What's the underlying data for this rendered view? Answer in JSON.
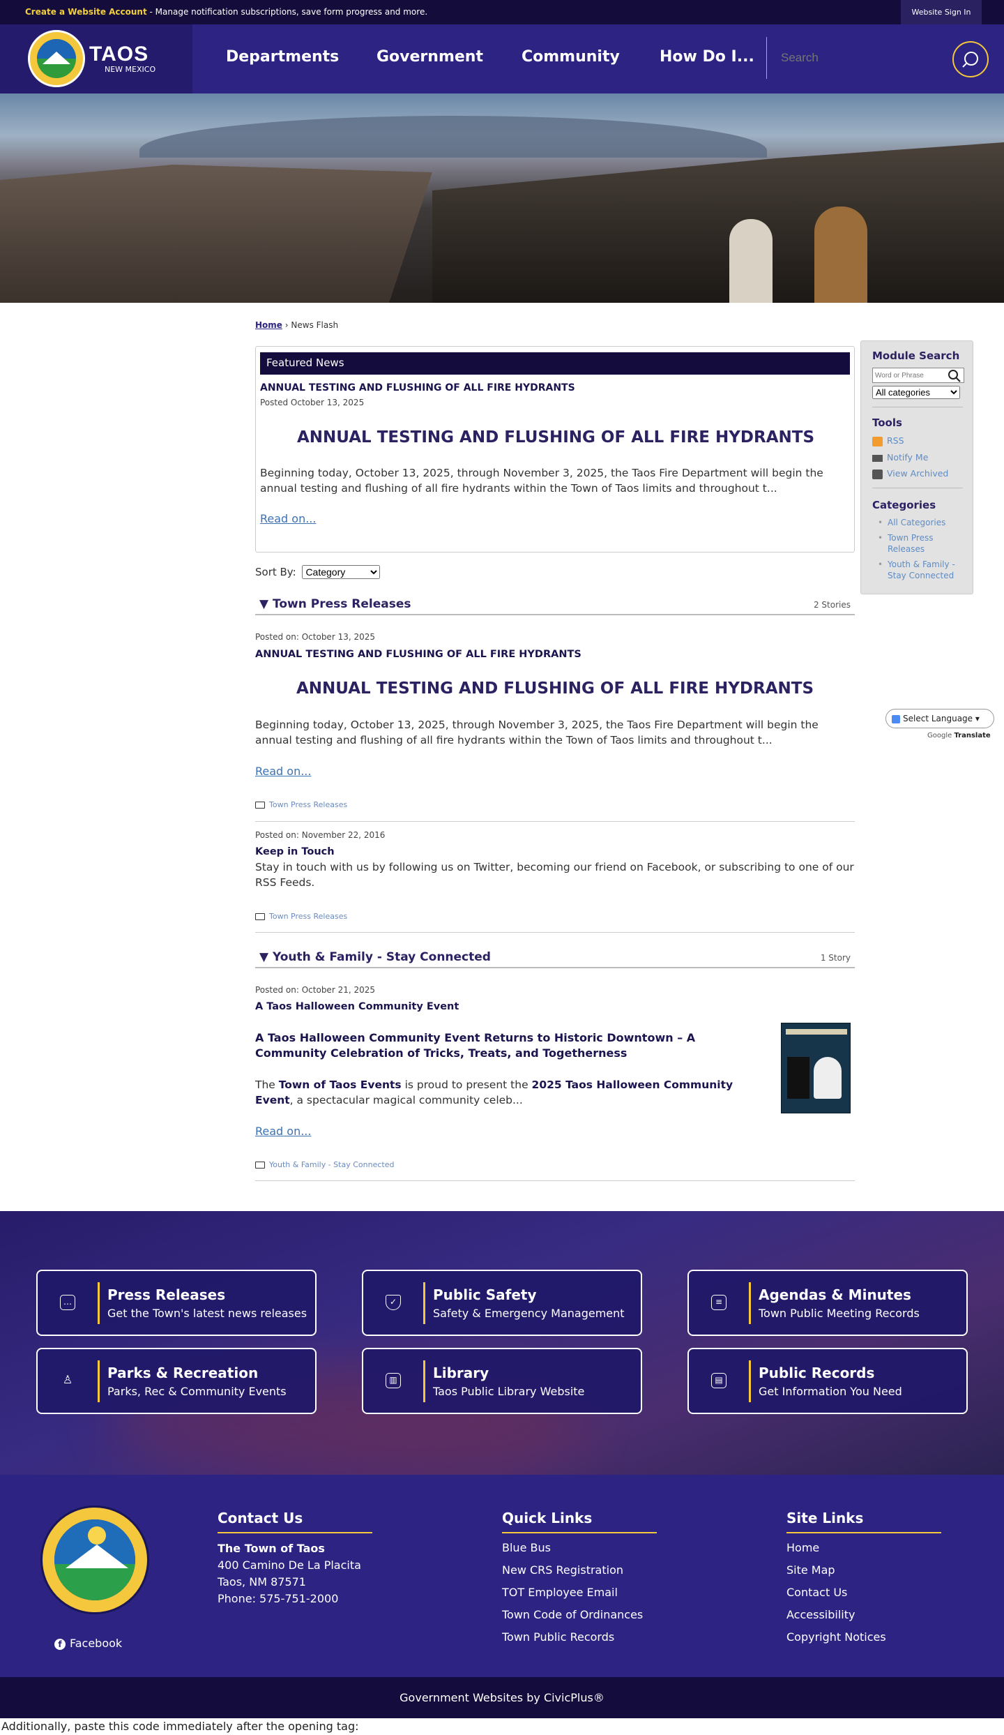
{
  "topbar": {
    "create_label": "Create a Website Account",
    "create_desc": " - Manage notification subscriptions, save form progress and more.",
    "signin_label": "Website Sign In"
  },
  "logo": {
    "title": "TAOS",
    "subtitle": "NEW MEXICO"
  },
  "nav": {
    "items": [
      "Departments",
      "Government",
      "Community",
      "How Do I..."
    ],
    "search_placeholder": "Search"
  },
  "breadcrumb": {
    "home": "Home",
    "separator": "›",
    "current": "News Flash"
  },
  "featured": {
    "heading": "Featured News",
    "title": "ANNUAL TESTING AND FLUSHING OF ALL FIRE HYDRANTS",
    "date": "Posted October 13, 2025",
    "headline": "ANNUAL TESTING AND FLUSHING OF ALL FIRE HYDRANTS",
    "body": "Beginning today, October 13, 2025, through November 3, 2025, the Taos Fire Department will begin the annual testing and flushing of all fire hydrants within the Town of Taos limits and throughout t...",
    "read_on": "Read on..."
  },
  "sort": {
    "label": "Sort By:",
    "selected": "Category"
  },
  "category1": {
    "name": "▼ Town Press Releases",
    "count": "2 Stories",
    "post1": {
      "date": "Posted on: October 13, 2025",
      "title": "ANNUAL TESTING AND FLUSHING OF ALL FIRE HYDRANTS",
      "headline": "ANNUAL TESTING AND FLUSHING OF ALL FIRE HYDRANTS",
      "body": "Beginning today, October 13, 2025, through November 3, 2025, the Taos Fire Department will begin the annual testing and flushing of all fire hydrants within the Town of Taos limits and throughout t...",
      "read_on": "Read on...",
      "tag": "Town Press Releases"
    },
    "post2": {
      "date": "Posted on: November 22, 2016",
      "title": "Keep in Touch",
      "body": "Stay in touch with us by following us on Twitter, becoming our friend on Facebook, or subscribing to one of our RSS Feeds.",
      "tag": "Town Press Releases"
    }
  },
  "category2": {
    "name": "▼ Youth & Family - Stay Connected",
    "count": "1 Story",
    "post1": {
      "date": "Posted on: October 21, 2025",
      "title": "A Taos Halloween Community Event",
      "headline": "A Taos Halloween Community Event Returns to Historic Downtown – A Community Celebration of Tricks, Treats, and Togetherness",
      "body_pre": "The ",
      "body_b1": "Town of Taos Events",
      "body_mid": " is proud to present the ",
      "body_b2": "2025 Taos Halloween Community Event",
      "body_post": ", a spectacular magical community celeb...",
      "read_on": "Read on...",
      "tag": "Youth & Family - Stay Connected"
    }
  },
  "sidebar": {
    "search_heading": "Module Search",
    "search_placeholder": "Word or Phrase",
    "category_select": "All categories",
    "tools_heading": "Tools",
    "tools": [
      "RSS",
      "Notify Me",
      "View Archived"
    ],
    "categories_heading": "Categories",
    "categories": [
      "All Categories",
      "Town Press Releases",
      "Youth & Family - Stay Connected"
    ]
  },
  "translate": {
    "label": "Select Language",
    "powered_prefix": "Google",
    "powered": "Translate"
  },
  "quick_links": [
    {
      "title": "Press Releases",
      "subtitle": "Get the Town's latest news releases",
      "icon": "chat-icon"
    },
    {
      "title": "Public Safety",
      "subtitle": "Safety & Emergency Management",
      "icon": "shield-icon"
    },
    {
      "title": "Agendas & Minutes",
      "subtitle": "Town Public Meeting Records",
      "icon": "calendar-icon"
    },
    {
      "title": "Parks & Recreation",
      "subtitle": "Parks, Rec & Community Events",
      "icon": "tree-icon"
    },
    {
      "title": "Library",
      "subtitle": "Taos Public Library Website",
      "icon": "book-icon"
    },
    {
      "title": "Public Records",
      "subtitle": "Get Information You Need",
      "icon": "document-icon"
    }
  ],
  "footer": {
    "facebook": "Facebook",
    "contact": {
      "heading": "Contact Us",
      "name": "The Town of Taos",
      "address1": "400 Camino De La Placita",
      "address2": "Taos, NM 87571",
      "phone": "Phone: 575-751-2000"
    },
    "quick": {
      "heading": "Quick Links",
      "links": [
        "Blue Bus",
        "New CRS Registration",
        "TOT Employee Email",
        "Town Code of Ordinances",
        "Town Public Records"
      ]
    },
    "site": {
      "heading": "Site Links",
      "links": [
        "Home",
        "Site Map",
        "Contact Us",
        "Accessibility",
        "Copyright Notices"
      ]
    },
    "credit": "Government Websites by CivicPlus®"
  },
  "tail_text": "Additionally, paste this code immediately after the opening tag:"
}
